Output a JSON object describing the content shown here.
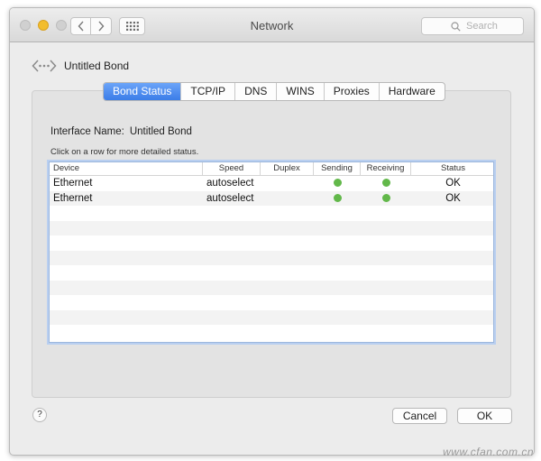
{
  "window": {
    "title": "Network"
  },
  "search": {
    "placeholder": "Search"
  },
  "bond": {
    "title": "Untitled Bond"
  },
  "tabs": [
    {
      "label": "Bond Status",
      "active": true
    },
    {
      "label": "TCP/IP",
      "active": false
    },
    {
      "label": "DNS",
      "active": false
    },
    {
      "label": "WINS",
      "active": false
    },
    {
      "label": "Proxies",
      "active": false
    },
    {
      "label": "Hardware",
      "active": false
    }
  ],
  "interface": {
    "label": "Interface Name:",
    "value": "Untitled Bond"
  },
  "hint": "Click on a row for more detailed status.",
  "table": {
    "columns": [
      "Device",
      "Speed",
      "Duplex",
      "Sending",
      "Receiving",
      "Status"
    ],
    "rows": [
      {
        "device": "Ethernet",
        "speed": "autoselect",
        "duplex": "",
        "sending": "green",
        "receiving": "green",
        "status": "OK"
      },
      {
        "device": "Ethernet",
        "speed": "autoselect",
        "duplex": "",
        "sending": "green",
        "receiving": "green",
        "status": "OK"
      }
    ]
  },
  "buttons": {
    "help": "?",
    "cancel": "Cancel",
    "ok": "OK"
  },
  "watermark": "www.cfan.com.cn",
  "colors": {
    "accent": "#3b7de8",
    "status_ok": "#62b84a"
  }
}
